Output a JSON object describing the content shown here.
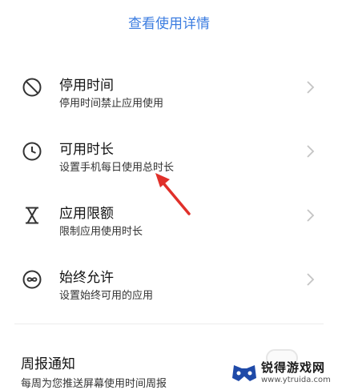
{
  "header": {
    "view_details": "查看使用详情"
  },
  "items": [
    {
      "title": "停用时间",
      "subtitle": "停用时间禁止应用使用",
      "icon": "block-icon"
    },
    {
      "title": "可用时长",
      "subtitle": "设置手机每日使用总时长",
      "icon": "clock-icon"
    },
    {
      "title": "应用限额",
      "subtitle": "限制应用使用时长",
      "icon": "hourglass-icon"
    },
    {
      "title": "始终允许",
      "subtitle": "设置始终可用的应用",
      "icon": "infinity-icon"
    }
  ],
  "weekly_report": {
    "title": "周报通知",
    "subtitle": "每周为您推送屏幕使用时间周报"
  },
  "watermark": {
    "name": "锐得游戏网",
    "url": "www.ytruida.com"
  },
  "colors": {
    "link": "#3c7de0",
    "arrow": "#e0302a",
    "chevron": "#c4c4c4"
  }
}
